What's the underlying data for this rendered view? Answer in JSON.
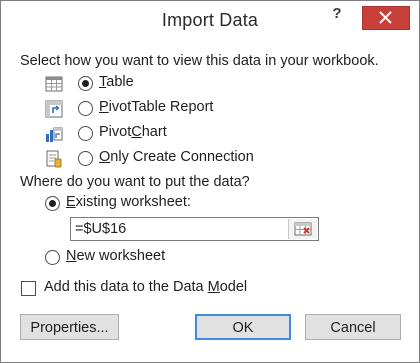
{
  "dialog": {
    "title": "Import Data",
    "help_label": "?",
    "close_icon": "close-icon"
  },
  "view_section": {
    "prompt": "Select how you want to view this data in your workbook.",
    "options": [
      {
        "label": "Table",
        "accel": "T",
        "rest": "able",
        "selected": true,
        "icon": "table-icon"
      },
      {
        "label": "PivotTable Report",
        "accel": "P",
        "rest": "ivotTable Report",
        "selected": false,
        "icon": "pivottable-icon"
      },
      {
        "label": "PivotChart",
        "pre": "Pivot",
        "accel": "C",
        "rest": "hart",
        "selected": false,
        "icon": "pivotchart-icon"
      },
      {
        "label": "Only Create Connection",
        "accel": "O",
        "rest": "nly Create Connection",
        "selected": false,
        "icon": "connection-icon"
      }
    ]
  },
  "location_section": {
    "prompt": "Where do you want to put the data?",
    "existing_label": "Existing worksheet:",
    "existing_accel": "E",
    "existing_rest": "xisting worksheet:",
    "existing_selected": true,
    "reference_value": "=$U$16",
    "new_label": "New worksheet",
    "new_accel": "N",
    "new_rest": "ew worksheet",
    "new_selected": false
  },
  "data_model": {
    "label": "Add this data to the Data Model",
    "accel": "M",
    "pre": "Add this data to the Data ",
    "rest": "odel",
    "checked": false
  },
  "buttons": {
    "properties": "Properties...",
    "ok": "OK",
    "cancel": "Cancel"
  }
}
